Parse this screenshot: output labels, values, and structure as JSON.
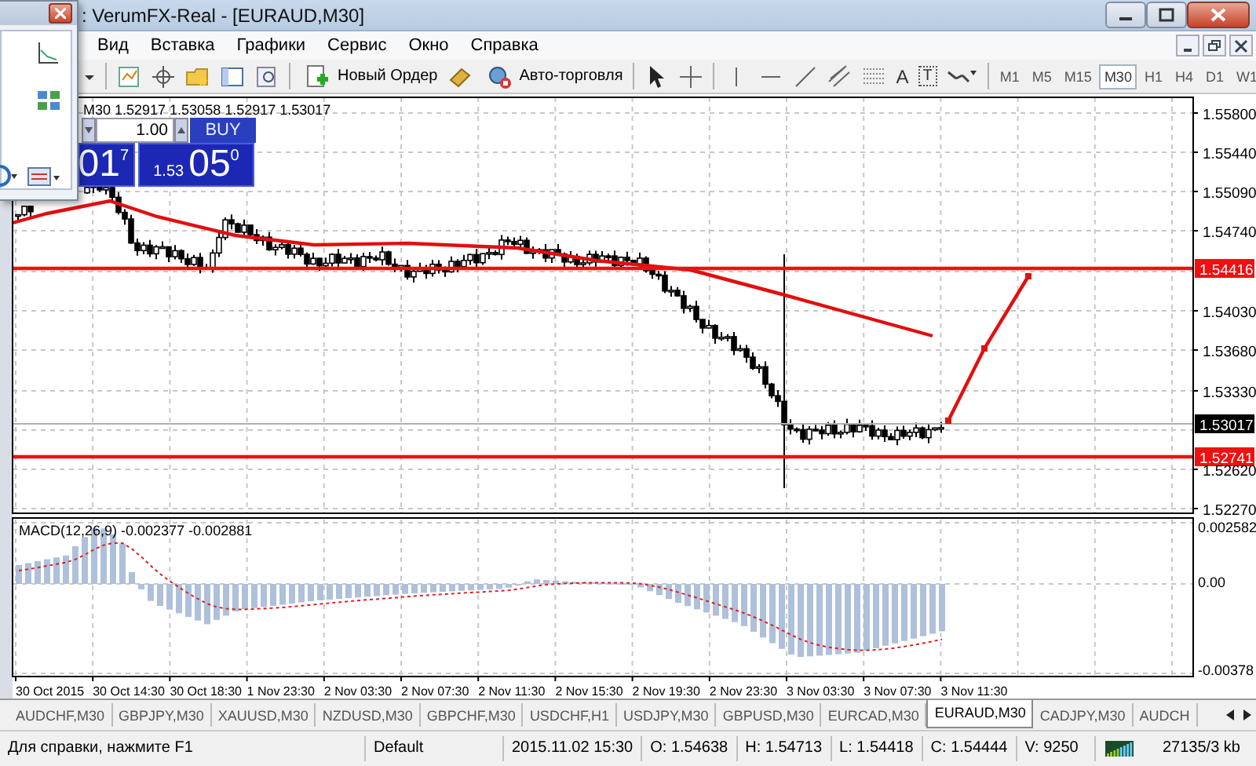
{
  "window": {
    "title": ": VerumFX-Real - [EURAUD,M30]"
  },
  "menu": [
    {
      "label": "Вид"
    },
    {
      "label": "Вставка"
    },
    {
      "label": "Графики"
    },
    {
      "label": "Сервис"
    },
    {
      "label": "Окно"
    },
    {
      "label": "Справка"
    }
  ],
  "toolbar": {
    "new_order": "Новый Ордер",
    "auto_trading": "Авто-торговля",
    "glyph_tools": [
      "A",
      "T"
    ],
    "timeframes": [
      {
        "label": "M1",
        "selected": false
      },
      {
        "label": "M5",
        "selected": false
      },
      {
        "label": "M15",
        "selected": false
      },
      {
        "label": "M30",
        "selected": true
      },
      {
        "label": "H1",
        "selected": false
      },
      {
        "label": "H4",
        "selected": false
      },
      {
        "label": "D1",
        "selected": false
      },
      {
        "label": "W1",
        "selected": false
      }
    ]
  },
  "chart": {
    "header": "M30 1.52917 1.53058 1.52917 1.53017",
    "one_click": {
      "volume": "1.00",
      "buy_label": "BUY",
      "sell_big": "01",
      "sell_sup": "7",
      "buy_prefix": "1.53",
      "buy_big": "05",
      "buy_sup": "0"
    },
    "price_labels": [
      "1.55800",
      "1.55440",
      "1.55090",
      "1.54740",
      "1.54030",
      "1.53680",
      "1.53330",
      "1.52620",
      "1.52270"
    ],
    "price_markers": [
      {
        "label": "1.54416",
        "kind": "level"
      },
      {
        "label": "1.53017",
        "kind": "bid"
      },
      {
        "label": "1.52741",
        "kind": "level"
      }
    ],
    "macd": {
      "label": "MACD(12,26,9) -0.002377 -0.002881",
      "axis": [
        "0.002582",
        "0.00",
        "-0.00378"
      ]
    },
    "time_labels": [
      "30 Oct 2015",
      "30 Oct 14:30",
      "30 Oct 18:30",
      "1 Nov 23:30",
      "2 Nov 03:30",
      "2 Nov 07:30",
      "2 Nov 11:30",
      "2 Nov 15:30",
      "2 Nov 19:30",
      "2 Nov 23:30",
      "3 Nov 03:30",
      "3 Nov 07:30",
      "3 Nov 11:30"
    ]
  },
  "symbol_tabs": [
    {
      "label": "AUDCHF,M30",
      "selected": false
    },
    {
      "label": "GBPJPY,M30",
      "selected": false
    },
    {
      "label": "XAUUSD,M30",
      "selected": false
    },
    {
      "label": "NZDUSD,M30",
      "selected": false
    },
    {
      "label": "GBPCHF,M30",
      "selected": false
    },
    {
      "label": "USDCHF,H1",
      "selected": false
    },
    {
      "label": "USDJPY,M30",
      "selected": false
    },
    {
      "label": "GBPUSD,M30",
      "selected": false
    },
    {
      "label": "EURCAD,M30",
      "selected": false
    },
    {
      "label": "EURAUD,M30",
      "selected": true
    },
    {
      "label": "CADJPY,M30",
      "selected": false
    },
    {
      "label": "AUDCH",
      "selected": false
    }
  ],
  "status_bar": {
    "help": "Для справки, нажмите F1",
    "profile": "Default",
    "time": "2015.11.02 15:30",
    "open": "O: 1.54638",
    "high": "H: 1.54713",
    "low": "L: 1.54418",
    "close": "C: 1.54444",
    "volume": "V: 9250",
    "traffic": "27135/3 kb"
  }
}
